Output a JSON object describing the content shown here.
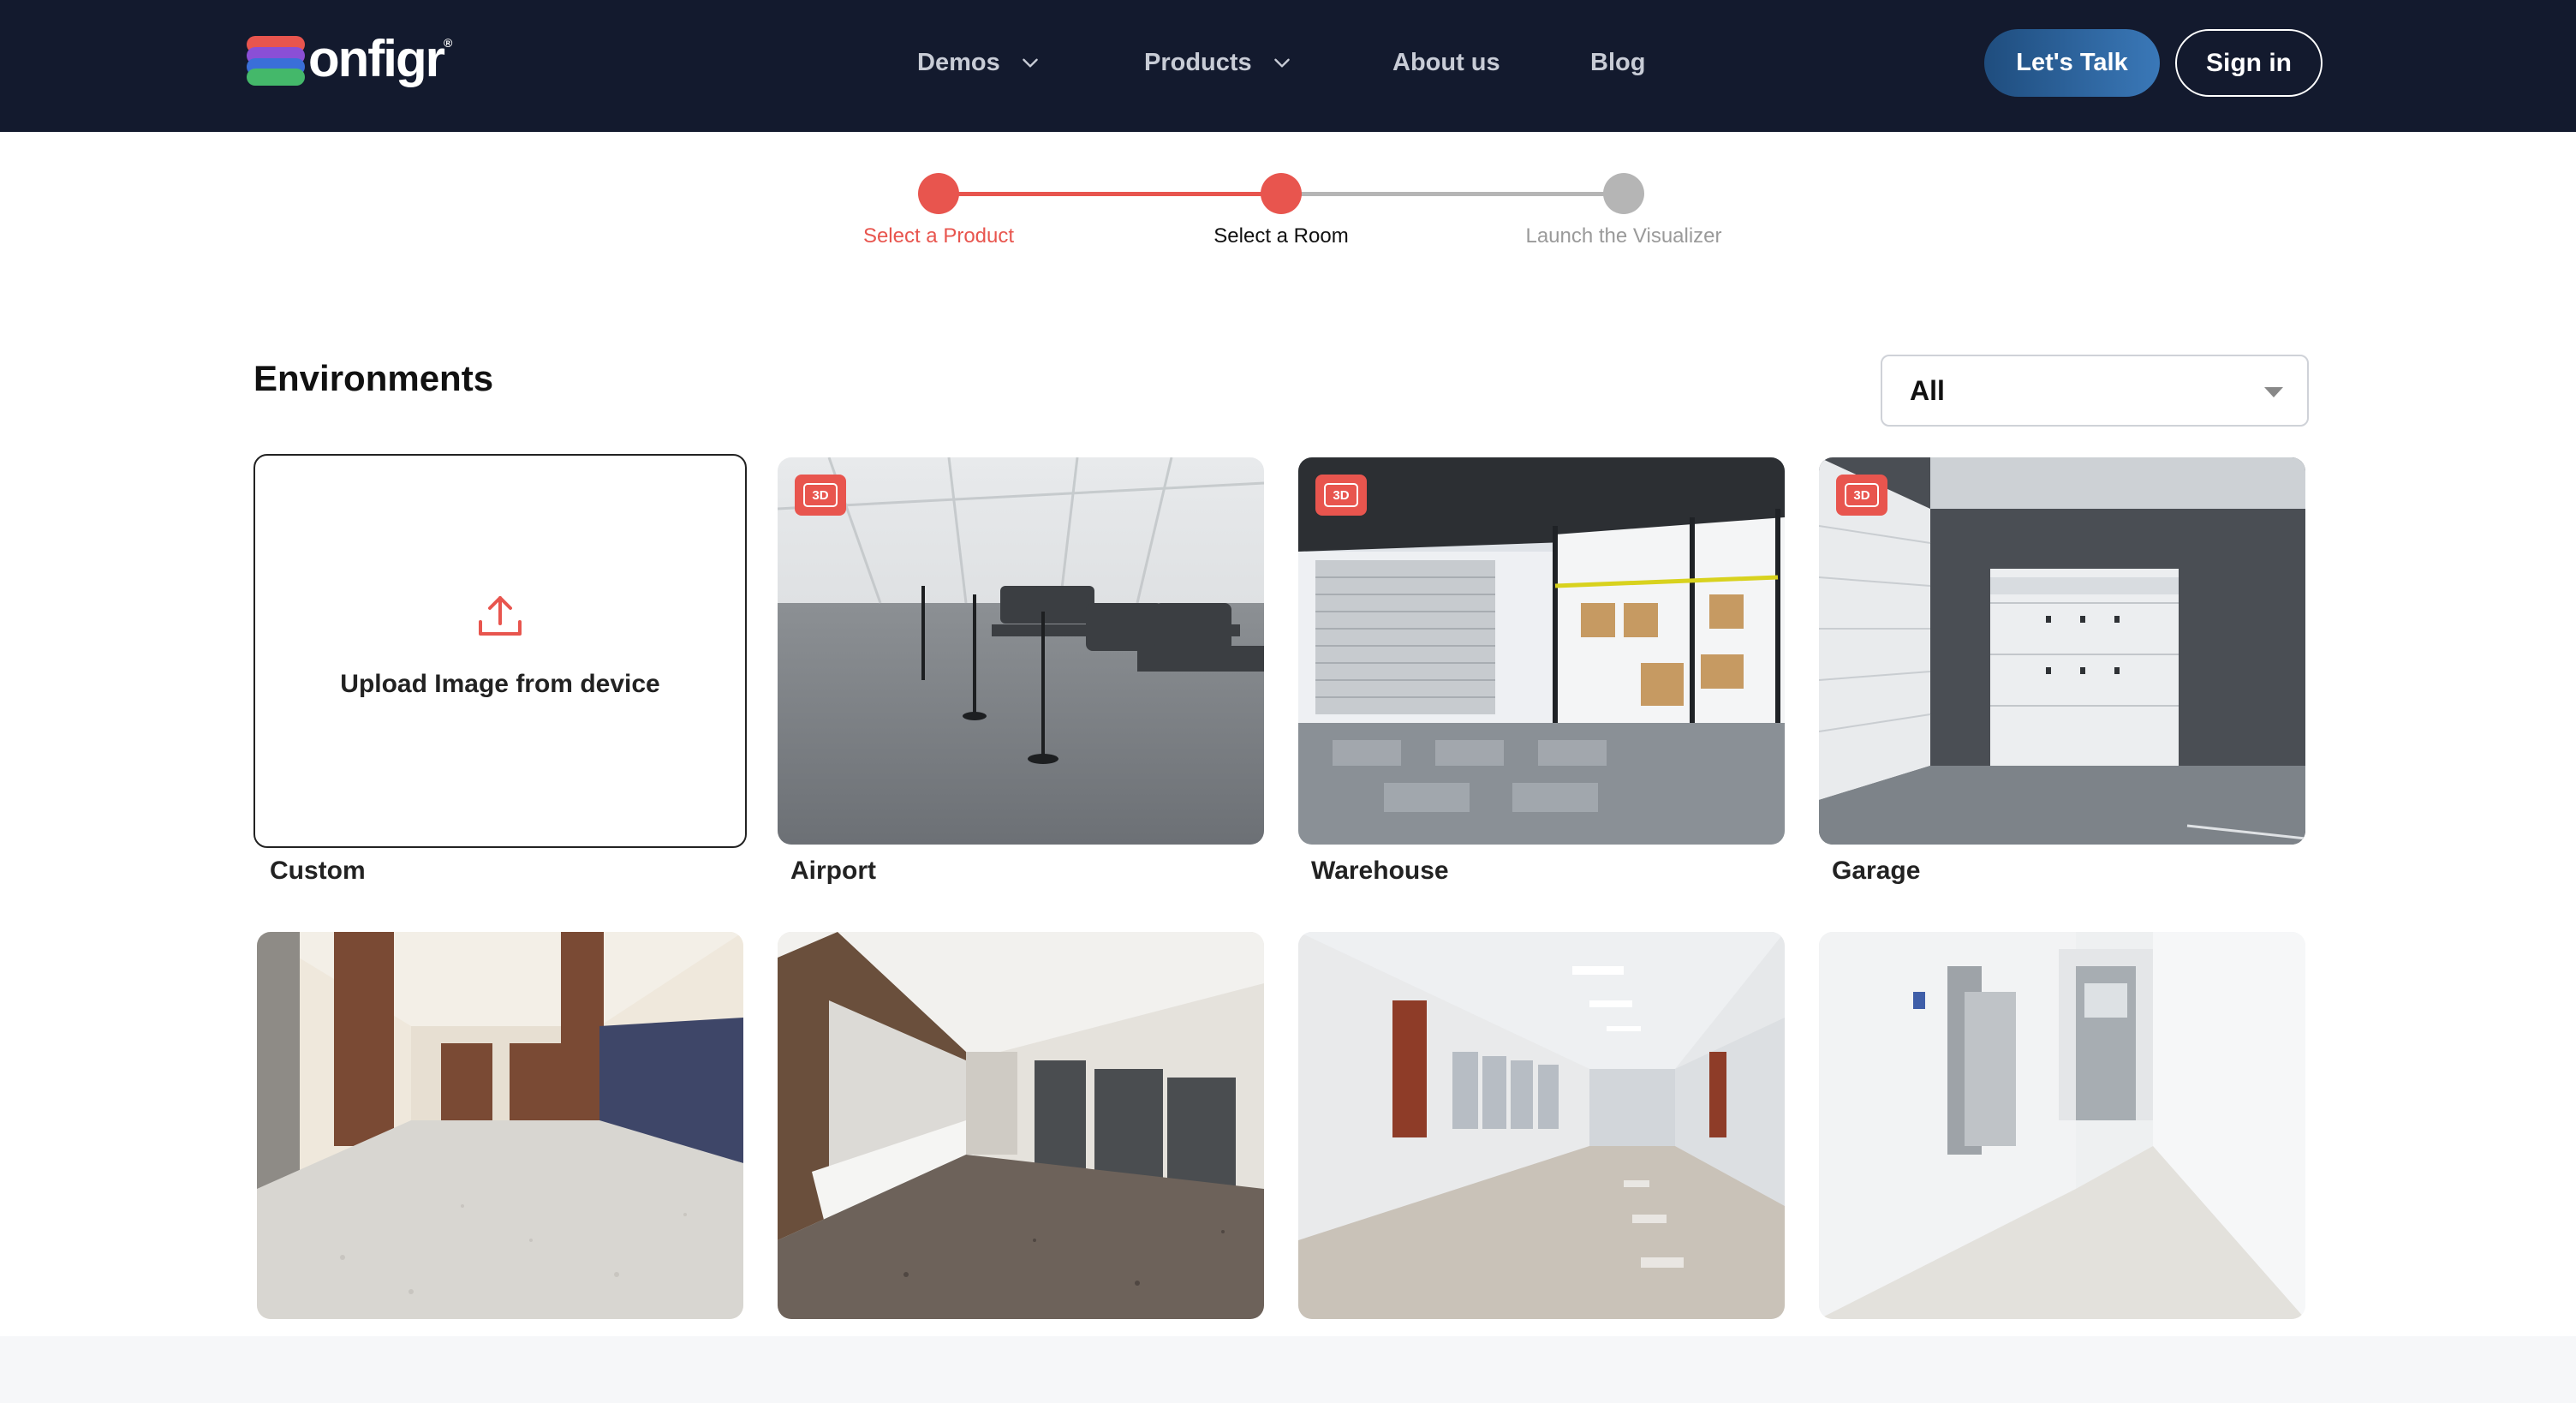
{
  "header": {
    "brand": "onfigr",
    "brand_mark": "®",
    "nav": [
      {
        "label": "Demos",
        "icon": "chevron-down-icon"
      },
      {
        "label": "Products",
        "icon": "chevron-down-icon"
      },
      {
        "label": "About us"
      },
      {
        "label": "Blog"
      }
    ],
    "cta_label": "Let's Talk",
    "signin_label": "Sign in"
  },
  "stepper": {
    "steps": [
      {
        "label": "Select a Product",
        "state": "done"
      },
      {
        "label": "Select a Room",
        "state": "active"
      },
      {
        "label": "Launch the Visualizer",
        "state": "pending"
      }
    ],
    "colors": {
      "active": "#e8554e",
      "pending": "#b5b5b5"
    }
  },
  "environments": {
    "title": "Environments",
    "filter_value": "All",
    "upload_label": "Upload Image from device",
    "badge_label": "3D",
    "cards": [
      {
        "label": "Custom"
      },
      {
        "label": "Airport",
        "badge": "3D"
      },
      {
        "label": "Warehouse",
        "badge": "3D"
      },
      {
        "label": "Garage",
        "badge": "3D"
      }
    ]
  },
  "colors": {
    "header_bg": "#131a2e",
    "accent": "#e8554e",
    "cta": "#2f6aa6"
  }
}
